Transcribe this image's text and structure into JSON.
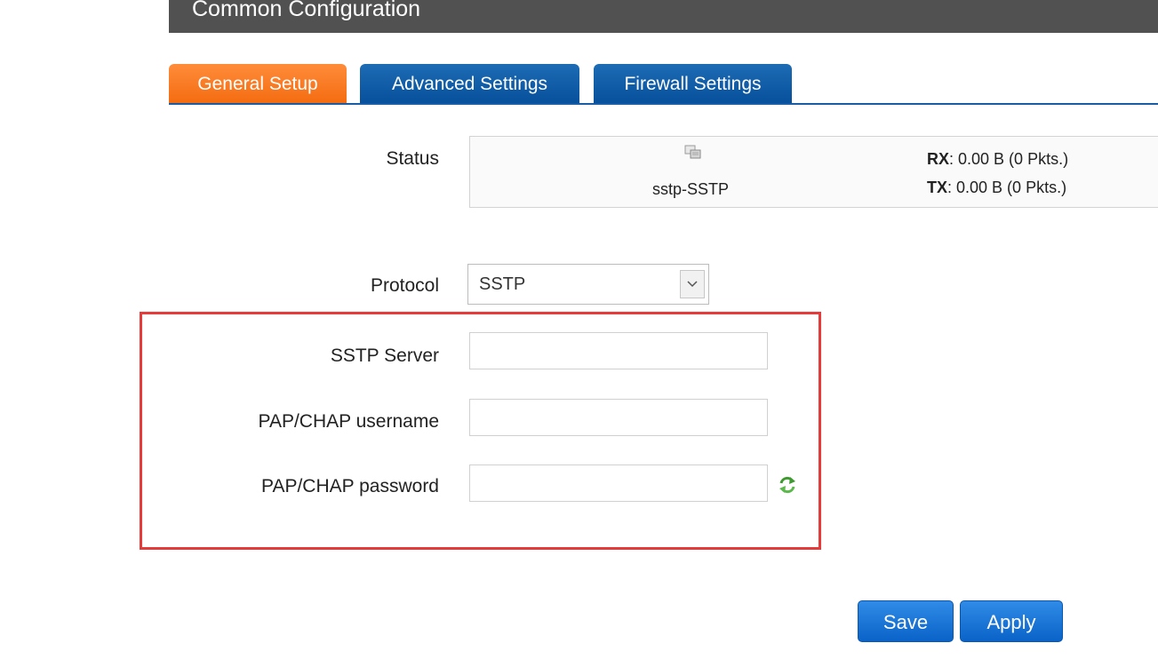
{
  "section": {
    "title": "Common Configuration"
  },
  "tabs": [
    {
      "label": "General Setup"
    },
    {
      "label": "Advanced Settings"
    },
    {
      "label": "Firewall Settings"
    }
  ],
  "status": {
    "label": "Status",
    "interface_name": "sstp-SSTP",
    "interface_icon": "network-interface-icon",
    "rx_label": "RX",
    "rx_value": ": 0.00 B (0 Pkts.)",
    "tx_label": "TX",
    "tx_value": ": 0.00 B (0 Pkts.)"
  },
  "protocol": {
    "label": "Protocol",
    "value": "SSTP"
  },
  "fields": {
    "server": {
      "label": "SSTP Server",
      "value": ""
    },
    "username": {
      "label": "PAP/CHAP username",
      "value": ""
    },
    "password": {
      "label": "PAP/CHAP password",
      "value": ""
    }
  },
  "buttons": {
    "save": "Save",
    "apply": "Apply"
  },
  "colors": {
    "header_bg": "#515151",
    "tab_active": "#f46c11",
    "tab_inactive": "#07509c",
    "highlight_border": "#e53b3b",
    "button_blue": "#0a63c8"
  }
}
